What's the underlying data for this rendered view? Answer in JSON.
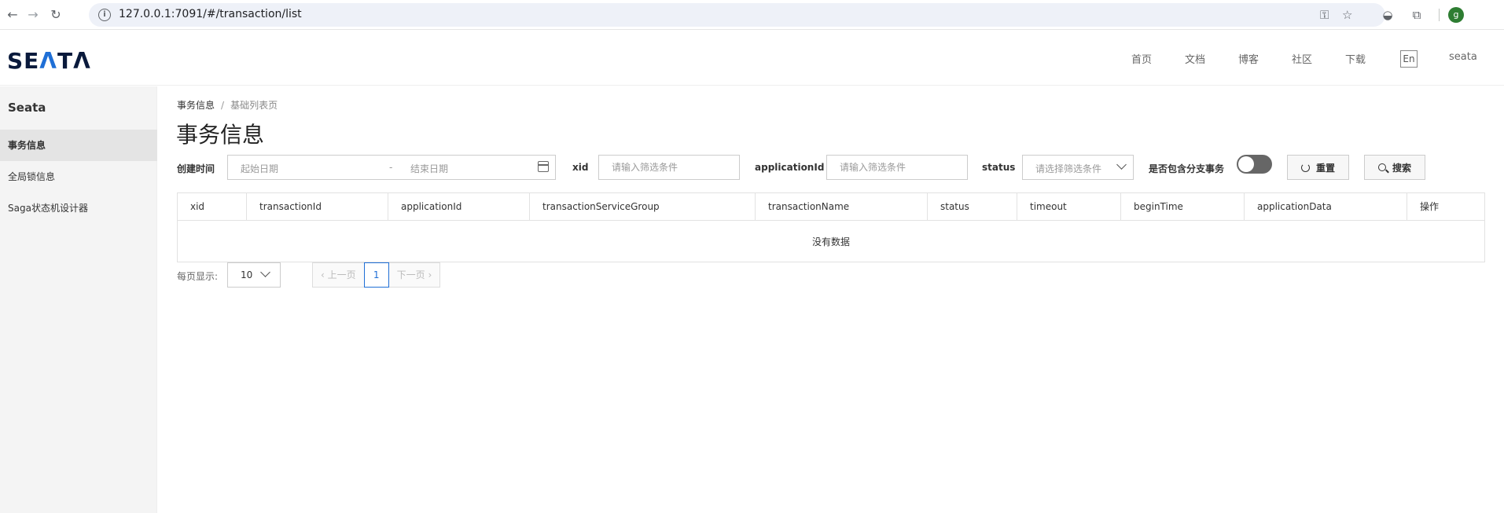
{
  "browser": {
    "url": "127.0.0.1:7091/#/transaction/list",
    "profile_initial": "g"
  },
  "header": {
    "logo_text_1": "SE",
    "logo_text_2": "Λ",
    "logo_text_3": "T",
    "logo_text_4": "Λ",
    "nav": [
      {
        "label": "首页"
      },
      {
        "label": "文档"
      },
      {
        "label": "博客"
      },
      {
        "label": "社区"
      },
      {
        "label": "下载"
      }
    ],
    "lang_toggle": "En",
    "user": "seata"
  },
  "sidebar": {
    "title": "Seata",
    "items": [
      {
        "label": "事务信息",
        "active": true
      },
      {
        "label": "全局锁信息",
        "active": false
      },
      {
        "label": "Saga状态机设计器",
        "active": false
      }
    ]
  },
  "breadcrumb": {
    "root": "事务信息",
    "separator": "/",
    "current": "基础列表页"
  },
  "page_title": "事务信息",
  "filters": {
    "created_time_label": "创建时间",
    "date_start_placeholder": "起始日期",
    "date_separator": "-",
    "date_end_placeholder": "结束日期",
    "xid_label": "xid",
    "xid_placeholder": "请输入筛选条件",
    "application_id_label": "applicationId",
    "application_id_placeholder": "请输入筛选条件",
    "status_label": "status",
    "status_placeholder": "请选择筛选条件",
    "include_branch_label": "是否包含分支事务",
    "include_branch_on": false,
    "reset_label": "重置",
    "search_label": "搜索"
  },
  "table": {
    "columns": [
      "xid",
      "transactionId",
      "applicationId",
      "transactionServiceGroup",
      "transactionName",
      "status",
      "timeout",
      "beginTime",
      "applicationData",
      "操作"
    ],
    "empty_text": "没有数据"
  },
  "pagination": {
    "page_size_label": "每页显示:",
    "page_size": "10",
    "prev_label": "上一页",
    "next_label": "下一页",
    "current_page": "1"
  },
  "colors": {
    "accent": "#1f6fd6",
    "logo_dark": "#0a1a3c",
    "switch_off": "#666666"
  }
}
